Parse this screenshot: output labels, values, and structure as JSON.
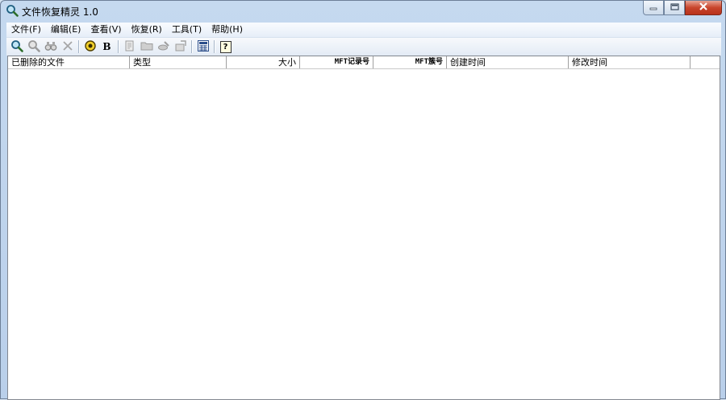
{
  "window": {
    "title": "文件恢复精灵 1.0"
  },
  "menubar": {
    "items": [
      "文件(F)",
      "编辑(E)",
      "查看(V)",
      "恢复(R)",
      "工具(T)",
      "帮助(H)"
    ]
  },
  "toolbar": {
    "buttons": [
      {
        "icon": "search-icon",
        "enabled": true
      },
      {
        "icon": "search-dim-icon",
        "enabled": false
      },
      {
        "icon": "binoculars-icon",
        "enabled": false
      },
      {
        "icon": "stop-x-icon",
        "enabled": false
      },
      {
        "icon": "target-icon",
        "enabled": true
      },
      {
        "icon": "bold-b-icon",
        "label": "B",
        "enabled": true
      },
      {
        "icon": "document-icon",
        "enabled": false
      },
      {
        "icon": "folder-icon",
        "enabled": false
      },
      {
        "icon": "recover-icon",
        "enabled": false
      },
      {
        "icon": "export-icon",
        "enabled": false
      },
      {
        "icon": "grid-icon",
        "enabled": true
      },
      {
        "icon": "help-icon",
        "label": "?",
        "enabled": true
      }
    ]
  },
  "list": {
    "columns": [
      {
        "label": "已删除的文件"
      },
      {
        "label": "类型"
      },
      {
        "label": "大小"
      },
      {
        "label": "MFT记录号"
      },
      {
        "label": "MFT簇号"
      },
      {
        "label": "创建时间"
      },
      {
        "label": "修改时间"
      }
    ],
    "rows": []
  }
}
